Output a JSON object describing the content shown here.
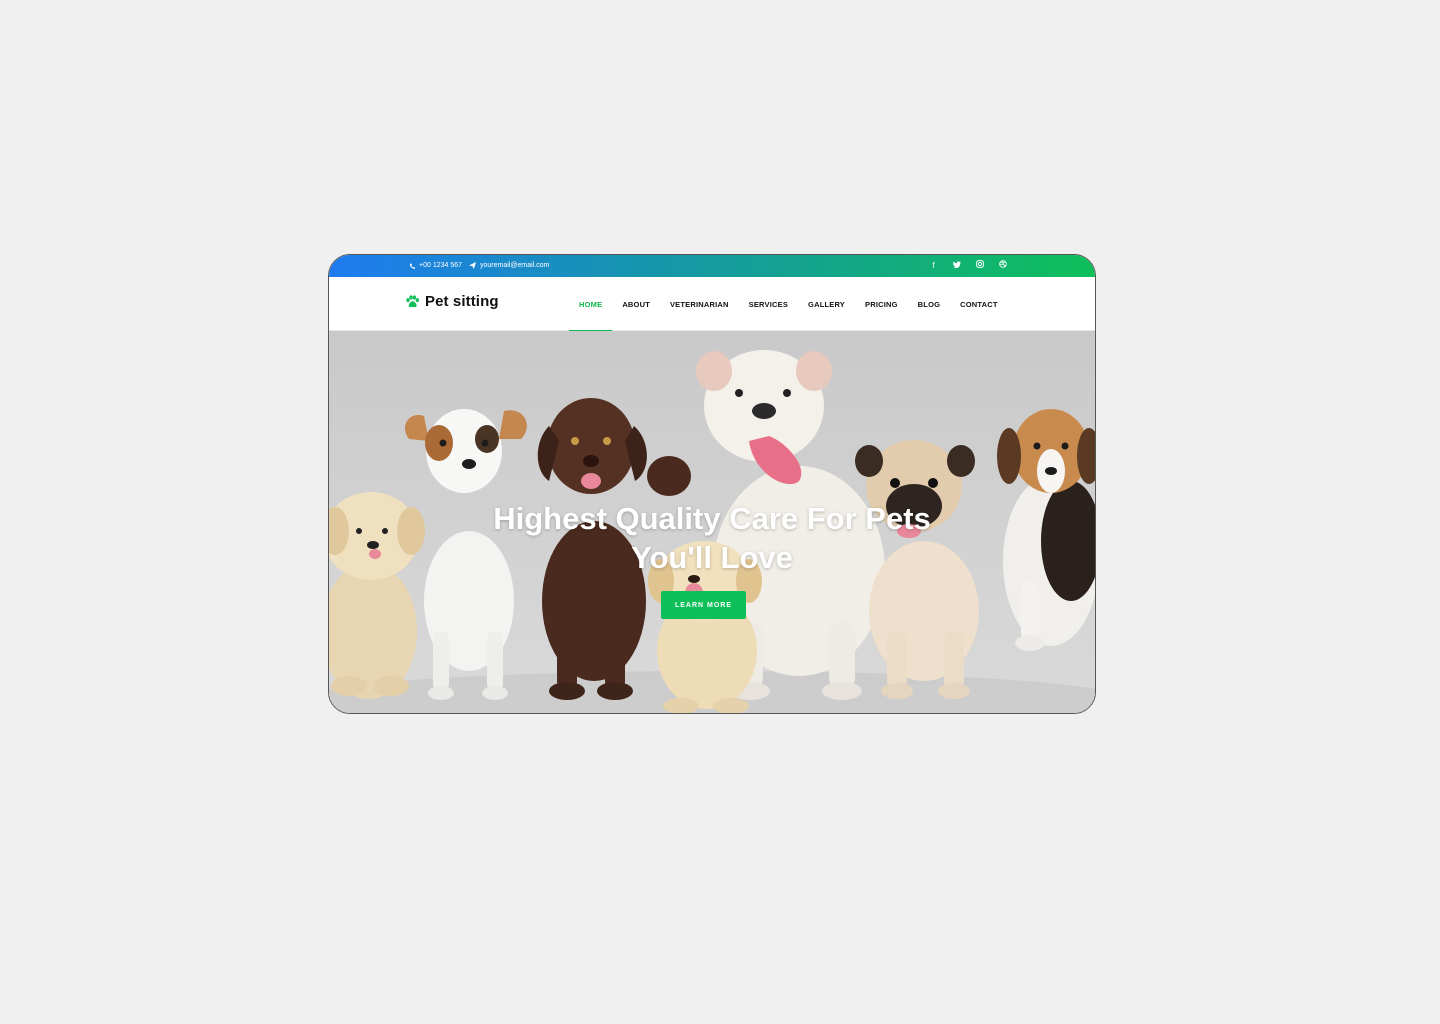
{
  "topbar": {
    "phone": "+00 1234 567",
    "email": "youremail@email.com",
    "social_icons": [
      "facebook-icon",
      "twitter-icon",
      "instagram-icon",
      "dribbble-icon"
    ]
  },
  "brand": {
    "name": "Pet sitting",
    "icon": "paw-icon"
  },
  "nav": {
    "items": [
      "HOME",
      "ABOUT",
      "VETERINARIAN",
      "SERVICES",
      "GALLERY",
      "PRICING",
      "BLOG",
      "CONTACT"
    ],
    "active": "HOME"
  },
  "hero": {
    "headline_line1": "Highest Quality Care For Pets",
    "headline_line2": "You'll Love",
    "cta_label": "LEARN MORE"
  },
  "colors": {
    "accent": "#0fbf5a",
    "gradient_start": "#1e7bf0",
    "gradient_end": "#0fbf5a"
  }
}
